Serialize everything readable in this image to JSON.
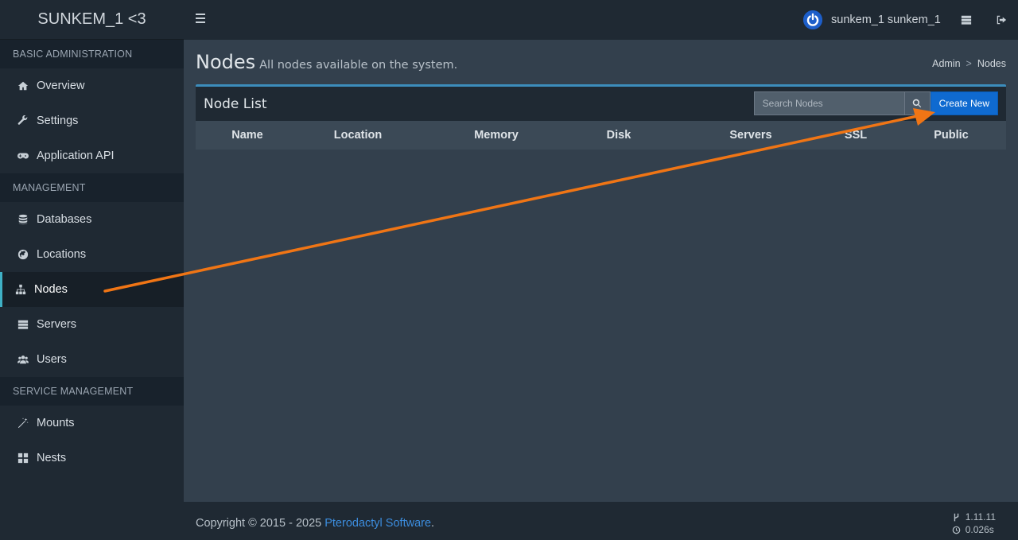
{
  "sidebar": {
    "brand": "SUNKEM_1 <3",
    "sections": [
      {
        "header": "BASIC ADMINISTRATION",
        "items": [
          {
            "label": "Overview",
            "icon": "home-icon"
          },
          {
            "label": "Settings",
            "icon": "wrench-icon"
          },
          {
            "label": "Application API",
            "icon": "gamepad-icon"
          }
        ]
      },
      {
        "header": "MANAGEMENT",
        "items": [
          {
            "label": "Databases",
            "icon": "database-icon"
          },
          {
            "label": "Locations",
            "icon": "globe-icon"
          },
          {
            "label": "Nodes",
            "icon": "sitemap-icon",
            "active": true
          },
          {
            "label": "Servers",
            "icon": "server-icon"
          },
          {
            "label": "Users",
            "icon": "users-icon"
          }
        ]
      },
      {
        "header": "SERVICE MANAGEMENT",
        "items": [
          {
            "label": "Mounts",
            "icon": "magic-icon"
          },
          {
            "label": "Nests",
            "icon": "th-large-icon"
          }
        ]
      }
    ]
  },
  "topbar": {
    "username": "sunkem_1 sunkem_1"
  },
  "page": {
    "title": "Nodes",
    "subtitle": "All nodes available on the system.",
    "breadcrumb": [
      "Admin",
      "Nodes"
    ],
    "breadcrumb_sep": ">"
  },
  "node_list": {
    "title": "Node List",
    "search_placeholder": "Search Nodes",
    "create_label": "Create New",
    "columns": [
      "Name",
      "Location",
      "Memory",
      "Disk",
      "Servers",
      "SSL",
      "Public"
    ]
  },
  "footer": {
    "copyright_prefix": "Copyright © 2015 - 2025 ",
    "copyright_link": "Pterodactyl Software",
    "copyright_suffix": ".",
    "version": "1.11.11",
    "time": "0.026s"
  },
  "colors": {
    "accent": "#3c8dbc",
    "primary_button": "#0f6ad0",
    "annotation_arrow": "#f07515",
    "active_indicator": "#3fb0c5"
  }
}
